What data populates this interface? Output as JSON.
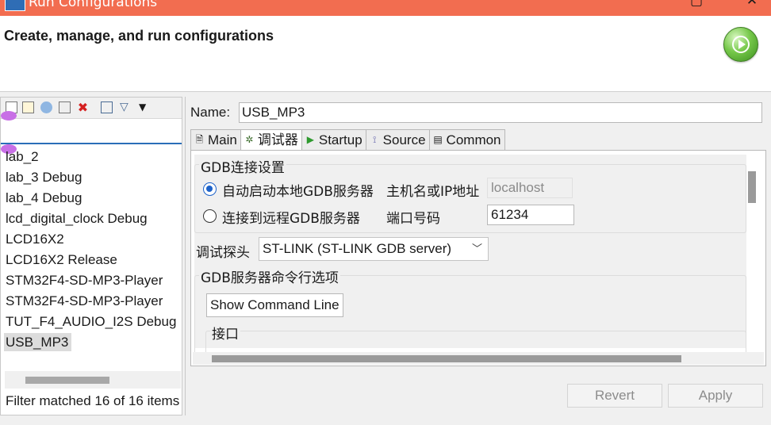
{
  "window": {
    "title": "Run Configurations"
  },
  "header": {
    "heading": "Create, manage, and run configurations"
  },
  "left": {
    "filter_placeholder": "",
    "items": [
      {
        "label": "lab_2",
        "selected": false
      },
      {
        "label": "lab_3 Debug",
        "selected": false
      },
      {
        "label": "lab_4 Debug",
        "selected": false
      },
      {
        "label": "lcd_digital_clock Debug",
        "selected": false
      },
      {
        "label": "LCD16X2",
        "selected": false
      },
      {
        "label": "LCD16X2 Release",
        "selected": false
      },
      {
        "label": "STM32F4-SD-MP3-Player",
        "selected": false
      },
      {
        "label": "STM32F4-SD-MP3-Player",
        "selected": false
      },
      {
        "label": "TUT_F4_AUDIO_I2S Debug",
        "selected": false
      },
      {
        "label": "USB_MP3",
        "selected": true
      }
    ],
    "status": "Filter matched 16 of 16 items"
  },
  "right": {
    "name_label": "Name:",
    "name_value": "USB_MP3",
    "tabs": [
      {
        "label": "Main",
        "icon": "main-tab-icon"
      },
      {
        "label": "调试器",
        "icon": "debugger-tab-icon",
        "active": true
      },
      {
        "label": "Startup",
        "icon": "startup-tab-icon"
      },
      {
        "label": "Source",
        "icon": "source-tab-icon"
      },
      {
        "label": "Common",
        "icon": "common-tab-icon"
      }
    ],
    "gdb_group": {
      "title": "GDB连接设置",
      "radio_local": "自动启动本地GDB服务器",
      "radio_remote": "连接到远程GDB服务器",
      "host_label": "主机名或IP地址",
      "host_value": "localhost",
      "port_label": "端口号码",
      "port_value": "61234",
      "selected": "local"
    },
    "probe_label": "调试探头",
    "probe_value": "ST-LINK (ST-LINK GDB server)",
    "cmd_group": {
      "title": "GDB服务器命令行选项",
      "show_button": "Show Command Line",
      "interface_label": "接口"
    },
    "revert_label": "Revert",
    "apply_label": "Apply"
  },
  "colors": {
    "titlebar": "#f26d50",
    "accent": "#1e63c9",
    "filter_line": "#2a6eb8"
  }
}
